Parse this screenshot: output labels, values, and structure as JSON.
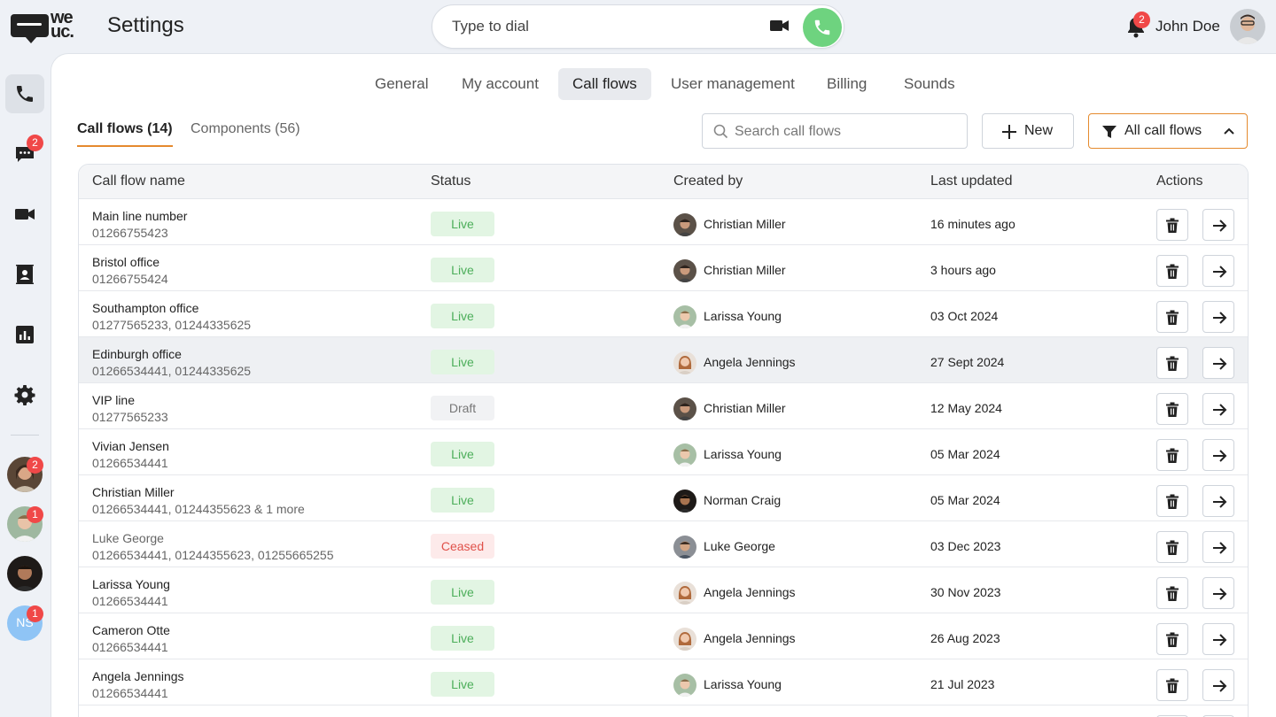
{
  "header": {
    "logo_text": "we\nuc.",
    "title": "Settings",
    "dial_placeholder": "Type to dial",
    "notification_count": "2",
    "user_name": "John Doe"
  },
  "rail": {
    "items": [
      "phone-icon",
      "chat-icon",
      "video-icon",
      "contacts-icon",
      "analytics-icon",
      "gear-icon"
    ],
    "chat_badge": "2",
    "contacts": [
      {
        "badge": "2",
        "initials": ""
      },
      {
        "badge": "1",
        "initials": ""
      },
      {
        "badge": "",
        "initials": ""
      },
      {
        "badge": "1",
        "initials": "NS"
      }
    ]
  },
  "tabs": [
    "General",
    "My account",
    "Call flows",
    "User management",
    "Billing",
    "Sounds"
  ],
  "active_tab": "Call flows",
  "subtabs": {
    "call_flows": "Call flows (14)",
    "components": "Components (56)"
  },
  "search": {
    "placeholder": "Search call flows"
  },
  "buttons": {
    "new": "New",
    "filter": "All call flows"
  },
  "table": {
    "columns": [
      "Call flow name",
      "Status",
      "Created by",
      "Last updated",
      "Actions"
    ],
    "rows": [
      {
        "name": "Main line number",
        "numbers": "01266755423",
        "status": "Live",
        "creator": "Christian Miller",
        "updated": "16 minutes ago"
      },
      {
        "name": "Bristol office",
        "numbers": "01266755424",
        "status": "Live",
        "creator": "Christian Miller",
        "updated": "3 hours ago"
      },
      {
        "name": "Southampton office",
        "numbers": "01277565233, 01244335625",
        "status": "Live",
        "creator": "Larissa Young",
        "updated": "03 Oct 2024"
      },
      {
        "name": "Edinburgh office",
        "numbers": "01266534441, 01244335625",
        "status": "Live",
        "creator": "Angela Jennings",
        "updated": "27 Sept 2024"
      },
      {
        "name": "VIP line",
        "numbers": "01277565233",
        "status": "Draft",
        "creator": "Christian Miller",
        "updated": "12 May 2024"
      },
      {
        "name": "Vivian Jensen",
        "numbers": "01266534441",
        "status": "Live",
        "creator": "Larissa Young",
        "updated": "05 Mar 2024"
      },
      {
        "name": "Christian Miller",
        "numbers": "01266534441, 01244355623 & 1 more",
        "status": "Live",
        "creator": "Norman Craig",
        "updated": "05 Mar 2024"
      },
      {
        "name": "Luke George",
        "numbers": "01266534441, 01244355623, 01255665255",
        "status": "Ceased",
        "creator": "Luke George",
        "updated": "03 Dec 2023"
      },
      {
        "name": "Larissa Young",
        "numbers": "01266534441",
        "status": "Live",
        "creator": "Angela Jennings",
        "updated": "30 Nov 2023"
      },
      {
        "name": "Cameron Otte",
        "numbers": "01266534441",
        "status": "Live",
        "creator": "Angela Jennings",
        "updated": "26 Aug 2023"
      },
      {
        "name": "Angela Jennings",
        "numbers": "01266534441",
        "status": "Live",
        "creator": "Larissa Young",
        "updated": "21 Jul 2023"
      },
      {
        "name": "",
        "numbers": "",
        "status": "",
        "creator": "",
        "updated": ""
      }
    ]
  },
  "colors": {
    "accent": "#e58a2e",
    "call_green": "#6ed37f",
    "badge_red": "#f04848",
    "live_green": "#4cae5a",
    "ceased_red": "#e0514a"
  }
}
